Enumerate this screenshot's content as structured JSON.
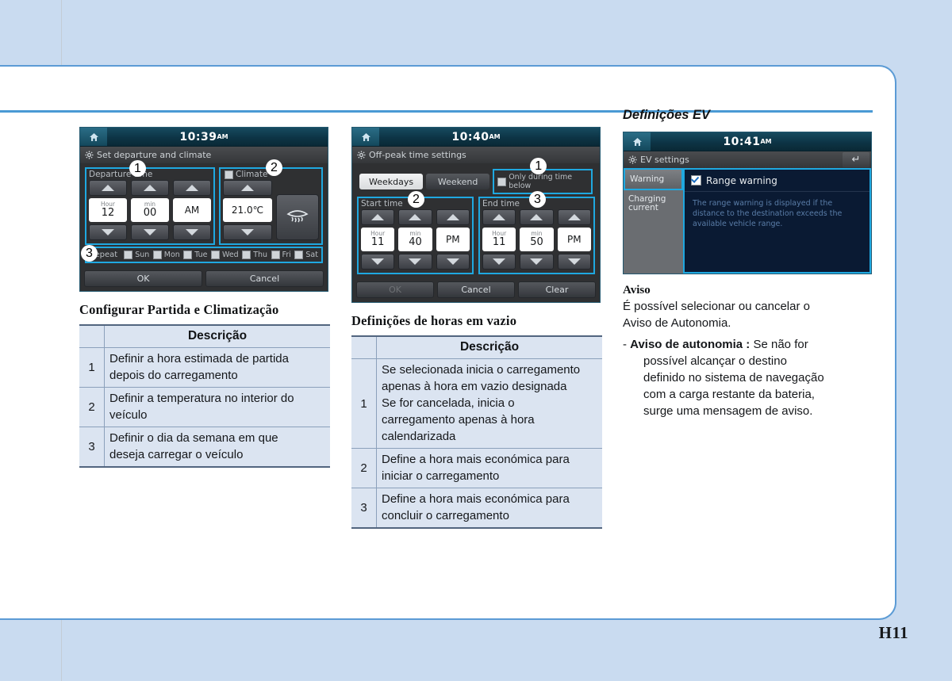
{
  "page": {
    "number": "H11",
    "accent_color": "#4a9ad4",
    "background_color": "#c9dbf0"
  },
  "screens": {
    "departure": {
      "clock": "10:39",
      "clock_ampm": "AM",
      "title": "Set departure and climate",
      "departure_group_label": "Departure time",
      "climate_label": "Climate",
      "hour_label": "Hour",
      "hour_value": "12",
      "min_label": "min",
      "min_value": "00",
      "ampm_value": "AM",
      "temperature_value": "21.0℃",
      "repeat_label": "Repeat",
      "days": [
        "Sun",
        "Mon",
        "Tue",
        "Wed",
        "Thu",
        "Fri",
        "Sat"
      ],
      "ok_label": "OK",
      "cancel_label": "Cancel",
      "callouts": [
        "1",
        "2",
        "3"
      ]
    },
    "offpeak": {
      "clock": "10:40",
      "clock_ampm": "AM",
      "title": "Off-peak time settings",
      "tab_weekdays": "Weekdays",
      "tab_weekend": "Weekend",
      "only_during_label": "Only during time below",
      "start_group_label": "Start time",
      "end_group_label": "End time",
      "hour_label": "Hour",
      "min_label": "min",
      "start_hour": "11",
      "start_min": "40",
      "start_ampm": "PM",
      "end_hour": "11",
      "end_min": "50",
      "end_ampm": "PM",
      "ok_label": "OK",
      "cancel_label": "Cancel",
      "clear_label": "Clear",
      "callouts": [
        "1",
        "2",
        "3"
      ]
    },
    "ev": {
      "clock": "10:41",
      "clock_ampm": "AM",
      "title": "EV settings",
      "tab_warning": "Warning",
      "tab_charging_current": "Charging\ncurrent",
      "range_warning_label": "Range warning",
      "range_warning_desc": "The range warning is displayed if the distance to the destination exceeds the available vehicle range."
    }
  },
  "columns": {
    "col1": {
      "caption": "Configurar Partida e Climatização",
      "table": {
        "header_desc": "Descrição",
        "rows": [
          {
            "num": "1",
            "line1": "Definir a hora estimada de partida",
            "line2": "depois do carregamento"
          },
          {
            "num": "2",
            "line1": "Definir a temperatura no interior do",
            "line2": "veículo"
          },
          {
            "num": "3",
            "line1": "Definir o dia da semana em que",
            "line2": "deseja carregar o veículo"
          }
        ]
      }
    },
    "col2": {
      "caption": "Definições de horas em vazio",
      "table": {
        "header_desc": "Descrição",
        "rows": [
          {
            "num": "1",
            "lines": [
              "Se selecionada inicia o carregamento",
              "apenas à hora em vazio designada",
              "Se for cancelada, inicia o",
              "carregamento apenas à hora",
              "calendarizada"
            ]
          },
          {
            "num": "2",
            "lines": [
              "Define a hora mais económica para",
              "iniciar o carregamento"
            ]
          },
          {
            "num": "3",
            "lines": [
              "Define a hora mais económica para",
              "concluir o carregamento"
            ]
          }
        ]
      }
    },
    "col3": {
      "section_title": "Definições EV",
      "note_head": "Aviso",
      "note_line1": "É possível selecionar ou cancelar o",
      "note_line2": "Aviso de Autonomia.",
      "bullet_dash": "-",
      "bullet_term": "Aviso de autonomia :",
      "bullet_line1": "Se não for",
      "bullet_line2": "possível alcançar o destino",
      "bullet_line3": "definido no sistema de navegação",
      "bullet_line4": "com a carga restante da bateria,",
      "bullet_line5": "surge uma mensagem de aviso."
    }
  }
}
